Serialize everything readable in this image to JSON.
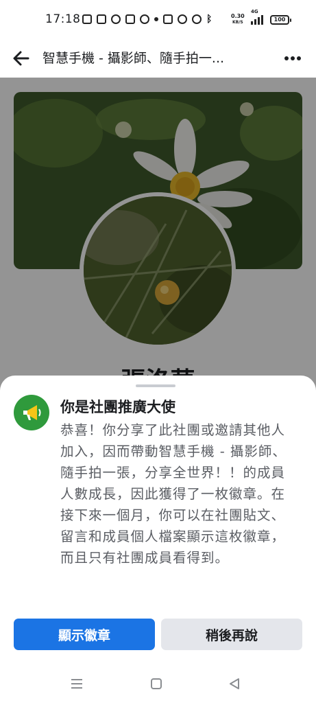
{
  "status_bar": {
    "time": "17:18",
    "net_speed_value": "0.30",
    "net_speed_unit": "KB/S",
    "network": "4G",
    "battery": "100"
  },
  "header": {
    "title": "智慧手機 - 攝影師、隨手拍一...",
    "back_icon": "arrow-left-icon",
    "more_icon": "more-horizontal-icon"
  },
  "profile": {
    "name": "張洛華"
  },
  "sheet": {
    "icon": "megaphone-icon",
    "title": "你是社團推廣大使",
    "body": "恭喜！你分享了此社團或邀請其他人加入，因而帶動智慧手機 - 攝影師、隨手拍一張，分享全世界！！的成員人數成長，因此獲得了一枚徽章。在接下來一個月，你可以在社團貼文、留言和成員個人檔案顯示這枚徽章，而且只有社團成員看得到。",
    "primary_button": "顯示徽章",
    "secondary_button": "稍後再說"
  },
  "colors": {
    "primary": "#1b74e4",
    "badge_green": "#2f9a3c",
    "secondary_button": "#e4e6eb"
  },
  "nav": {
    "recents_icon": "menu-icon",
    "home_icon": "square-icon",
    "back_icon": "triangle-back-icon"
  }
}
